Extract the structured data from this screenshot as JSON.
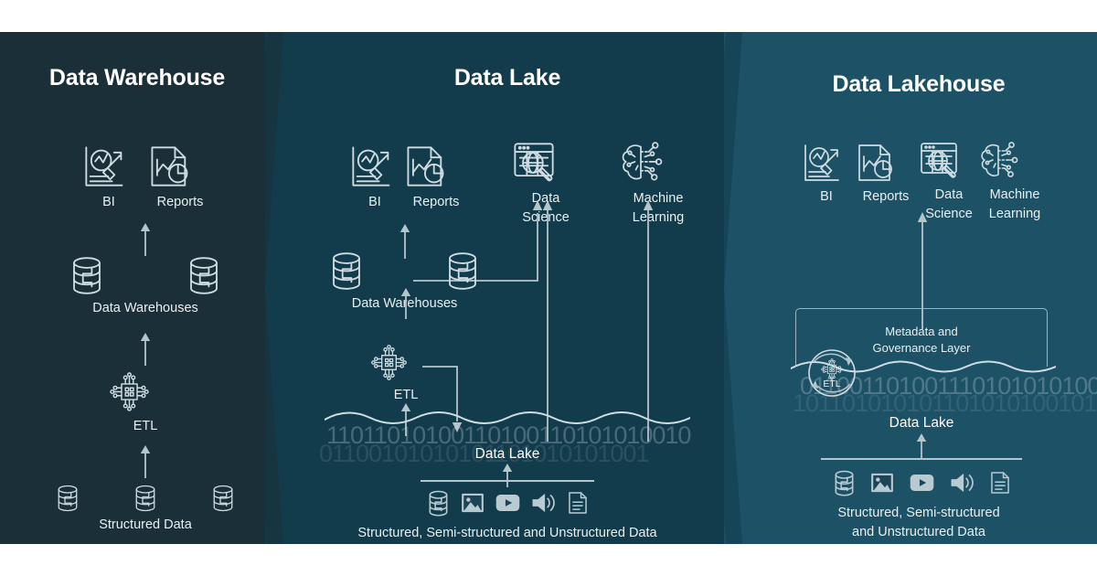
{
  "meta": {
    "bg": "#ffffff",
    "panel1_color": "#1b2f38",
    "panel2_color": "#123c4c",
    "panel3_color": "#1c5166",
    "line_color": "#b4c5cc",
    "text_color": "#e9eff2"
  },
  "panels": [
    {
      "id": "data-warehouse",
      "title": "Data Warehouse",
      "consumers": [
        {
          "label": "BI",
          "icon": "bi-chart-magnifier-icon"
        },
        {
          "label": "Reports",
          "icon": "report-document-icon"
        }
      ],
      "storage_label": "Data Warehouses",
      "storage_icon": "database-cylinder-icon",
      "storage_count": 2,
      "process_label": "ETL",
      "process_icon": "etl-chip-icon",
      "source_label": "Structured Data",
      "source_icon": "database-cylinder-icon",
      "source_count": 3
    },
    {
      "id": "data-lake",
      "title": "Data Lake",
      "consumers": [
        {
          "label": "BI",
          "icon": "bi-chart-magnifier-icon"
        },
        {
          "label": "Reports",
          "icon": "report-document-icon"
        },
        {
          "label": "Data\nScience",
          "icon": "data-science-globe-icon"
        },
        {
          "label": "Machine\nLearning",
          "icon": "machine-learning-brain-icon"
        }
      ],
      "storage_label": "Data Warehouses",
      "storage_icon": "database-cylinder-icon",
      "storage_count": 2,
      "process_label": "ETL",
      "process_icon": "etl-chip-icon",
      "lake_label": "Data Lake",
      "binary_top": "11011010100110100110101010010",
      "binary_bottom": "01100101010101101010101001",
      "sources": [
        {
          "icon": "database-cylinder-icon"
        },
        {
          "icon": "image-photo-icon"
        },
        {
          "icon": "video-play-icon"
        },
        {
          "icon": "audio-speaker-icon"
        },
        {
          "icon": "document-file-icon"
        }
      ],
      "source_label": "Structured, Semi-structured and Unstructured Data"
    },
    {
      "id": "data-lakehouse",
      "title": "Data Lakehouse",
      "consumers": [
        {
          "label": "BI",
          "icon": "bi-chart-magnifier-icon"
        },
        {
          "label": "Reports",
          "icon": "report-document-icon"
        },
        {
          "label": "Data\nScience",
          "icon": "data-science-globe-icon"
        },
        {
          "label": "Machine\nLearning",
          "icon": "machine-learning-brain-icon"
        }
      ],
      "governance_label": "Metadata and\nGovernance Layer",
      "process_label": "ETL",
      "process_icon": "etl-chip-cycle-icon",
      "lake_label": "Data Lake",
      "binary_top": "0110011010011101010101001010",
      "binary_bottom": "101101010101101010100101",
      "sources": [
        {
          "icon": "database-cylinder-icon"
        },
        {
          "icon": "image-photo-icon"
        },
        {
          "icon": "video-play-icon"
        },
        {
          "icon": "audio-speaker-icon"
        },
        {
          "icon": "document-file-icon"
        }
      ],
      "source_label": "Structured, Semi-structured\nand Unstructured Data"
    }
  ]
}
